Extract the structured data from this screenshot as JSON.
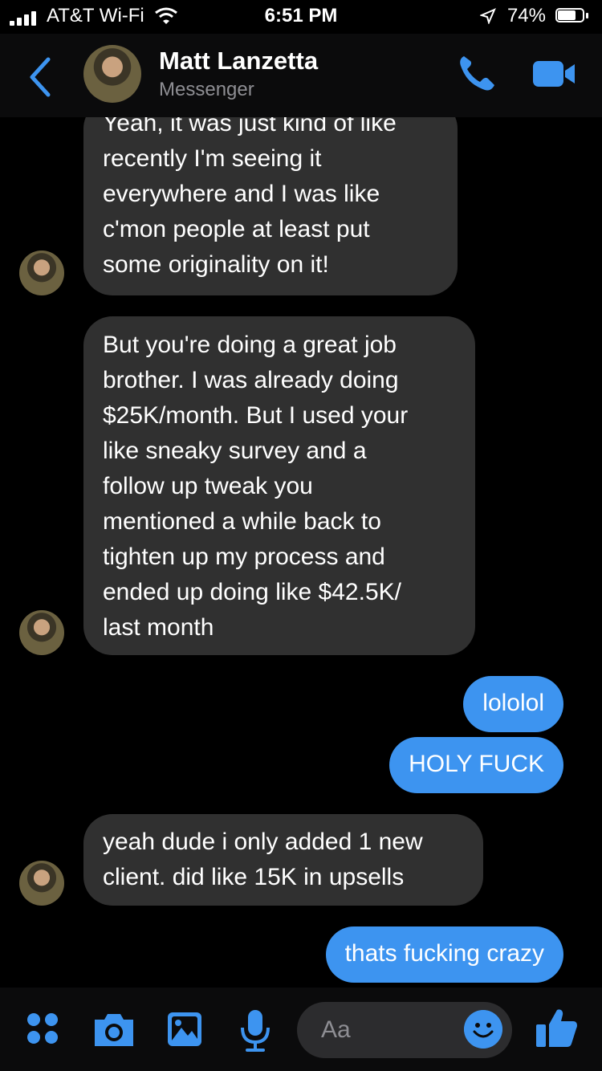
{
  "status_bar": {
    "carrier": "AT&T Wi-Fi",
    "time": "6:51 PM",
    "battery": "74%",
    "battery_level": 0.74
  },
  "header": {
    "contact_name": "Matt Lanzetta",
    "subtitle": "Messenger",
    "icons": [
      "back-icon",
      "phone-icon",
      "video-camera-icon"
    ]
  },
  "messages": [
    {
      "direction": "in",
      "lines": [
        "Yeah, it was just kind of like",
        "recently I'm seeing it",
        "everywhere and I was like",
        "c'mon people at least put",
        "some originality on it!"
      ]
    },
    {
      "direction": "in",
      "lines": [
        "But you're doing a great job",
        "brother. I was already doing",
        "$25K/month. But I used your",
        "like sneaky survey and a",
        "follow up tweak you",
        "mentioned a while back to",
        "tighten up my process and",
        "ended up doing like $42.5K/",
        "last month"
      ]
    },
    {
      "direction": "out",
      "text": "lololol"
    },
    {
      "direction": "out",
      "text": "HOLY FUCK"
    },
    {
      "direction": "in",
      "lines": [
        "yeah dude i only added 1 new",
        "client. did like 15K in upsells"
      ]
    },
    {
      "direction": "out",
      "text": "thats fucking crazy"
    }
  ],
  "composer": {
    "placeholder": "Aa",
    "icons": [
      "apps-icon",
      "camera-icon",
      "image-icon",
      "microphone-icon",
      "emoji-icon",
      "thumbs-up-icon"
    ]
  },
  "colors": {
    "accent": "#3d94f0",
    "incoming_bubble": "#303030",
    "background": "#000000"
  }
}
